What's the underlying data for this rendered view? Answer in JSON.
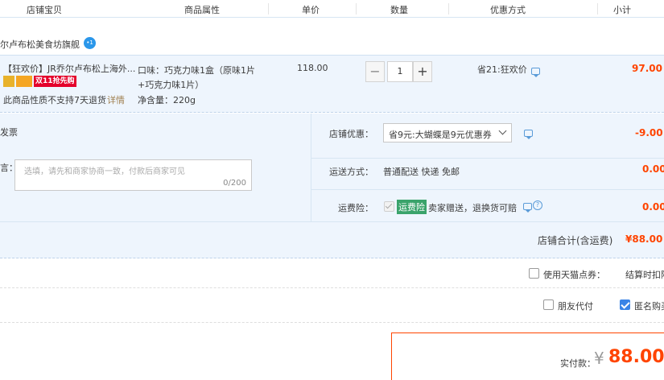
{
  "columns": [
    "店铺宝贝",
    "商品属性",
    "单价",
    "数量",
    "优惠方式",
    "小计"
  ],
  "shop": {
    "name": "尔卢布松美食坊旗舰"
  },
  "item": {
    "title": "【狂欢价】JR乔尔卢布松上海外...",
    "promo_tag": "双11抢先购",
    "notice": "此商品性质不支持7天退货",
    "notice_link": "详情",
    "attr_line1": "口味：巧克力味1盒（原味1片",
    "attr_line2": "+巧克力味1片）",
    "attr_line3": "净含量：220g",
    "price": "118.00",
    "quantity": "1",
    "minus": "−",
    "plus": "+",
    "discount": "省21:狂欢价",
    "subtotal": "97.00"
  },
  "order": {
    "invoice_label": "发票",
    "message_label": "言：",
    "message_placeholder": "选填，请先和商家协商一致，付款后商家可见",
    "message_count": "0/200",
    "shop_discount_label": "店铺优惠：",
    "shop_discount_value": "省9元:大蝴蝶是9元优惠券",
    "shop_discount_amount": "-9.00",
    "shipping_label": "运送方式：",
    "shipping_value": "普通配送 快递 免邮",
    "shipping_amount": "0.00",
    "insurance_label": "运费险：",
    "insurance_tag": "运费险",
    "insurance_text": "卖家赠送，退换货可赔",
    "insurance_amount": "0.00",
    "shop_total_label": "店铺合计(含运费)",
    "shop_total_value": "¥88.00"
  },
  "options": {
    "points_label": "使用天猫点券：",
    "points_note": "结算时扣除",
    "friend_pay_label": "朋友代付",
    "anonymous_label": "匿名购买"
  },
  "payment": {
    "label": "实付款：",
    "currency": "¥",
    "amount": "88.00"
  },
  "colors": {
    "accent_red": "#ff4400",
    "brand_blue": "#3a84e6",
    "row_bg": "#eef5fd"
  }
}
